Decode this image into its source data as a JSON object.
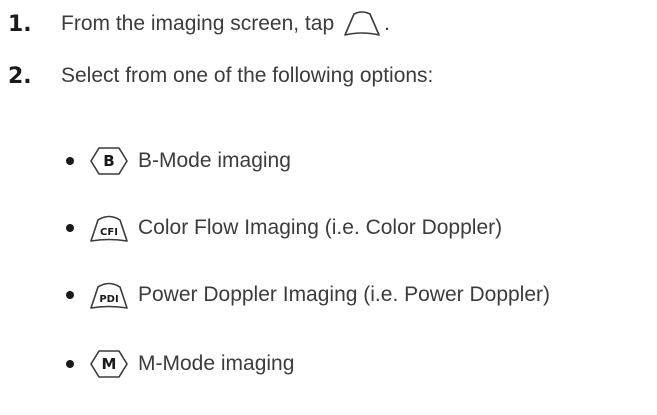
{
  "steps": [
    {
      "number": "1.",
      "text": "From the imaging screen, tap",
      "suffix": ".",
      "icon": "probe-outline-icon"
    },
    {
      "number": "2.",
      "text": "Select from one of the following options:"
    }
  ],
  "options": [
    {
      "icon_label": "B",
      "icon": "b-mode-icon",
      "text": "B-Mode imaging"
    },
    {
      "icon_label": "CFI",
      "icon": "cfi-icon",
      "text": "Color Flow Imaging (i.e. Color Doppler)"
    },
    {
      "icon_label": "PDI",
      "icon": "pdi-icon",
      "text": "Power Doppler Imaging (i.e. Power Doppler)"
    },
    {
      "icon_label": "M",
      "icon": "m-mode-icon",
      "text": "M-Mode imaging"
    }
  ]
}
